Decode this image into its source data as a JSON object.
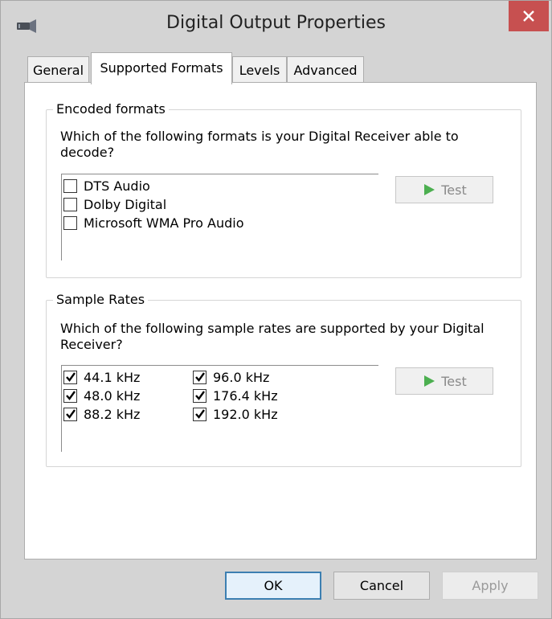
{
  "window": {
    "title": "Digital Output Properties",
    "close_glyph": "✕"
  },
  "tabs": [
    {
      "label": "General",
      "active": false
    },
    {
      "label": "Supported Formats",
      "active": true
    },
    {
      "label": "Levels",
      "active": false
    },
    {
      "label": "Advanced",
      "active": false
    }
  ],
  "encoded": {
    "title": "Encoded formats",
    "prompt": "Which of the following formats is your Digital Receiver able to decode?",
    "items": [
      {
        "label": "DTS Audio",
        "checked": false
      },
      {
        "label": "Dolby Digital",
        "checked": false
      },
      {
        "label": "Microsoft WMA Pro Audio",
        "checked": false
      }
    ],
    "test_label": "Test"
  },
  "rates": {
    "title": "Sample Rates",
    "prompt": "Which of the following sample rates are supported by your Digital Receiver?",
    "items": [
      {
        "label": "44.1 kHz",
        "checked": true
      },
      {
        "label": "48.0 kHz",
        "checked": true
      },
      {
        "label": "88.2 kHz",
        "checked": true
      },
      {
        "label": "96.0 kHz",
        "checked": true
      },
      {
        "label": "176.4 kHz",
        "checked": true
      },
      {
        "label": "192.0 kHz",
        "checked": true
      }
    ],
    "test_label": "Test"
  },
  "buttons": {
    "ok": "OK",
    "cancel": "Cancel",
    "apply": "Apply"
  },
  "colors": {
    "close_bg": "#c75050",
    "play_green": "#4caf50",
    "default_border": "#3c7fb1"
  },
  "icons": {
    "title": "speaker-device-icon",
    "test": "play-icon",
    "check": "checkmark-icon"
  }
}
